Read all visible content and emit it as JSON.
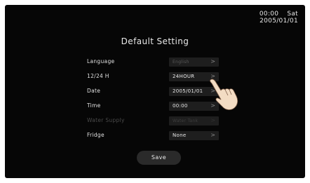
{
  "status": {
    "time": "00:00",
    "day": "Sat",
    "date": "2005/01/01"
  },
  "title": "Default Setting",
  "settings": [
    {
      "label": "Language",
      "value": "English",
      "state": "dim"
    },
    {
      "label": "12/24 H",
      "value": "24HOUR",
      "state": "active"
    },
    {
      "label": "Date",
      "value": "2005/01/01",
      "state": "active"
    },
    {
      "label": "Time",
      "value": "00:00",
      "state": "active"
    },
    {
      "label": "Water Supply",
      "value": "Water Tank",
      "state": "disabled"
    },
    {
      "label": "Fridge",
      "value": "None",
      "state": "active"
    }
  ],
  "save_label": "Save",
  "icons": {
    "arrow": "chevron-right-icon",
    "pointer": "hand-pointer-icon"
  },
  "colors": {
    "background": "#060606",
    "field": "#1e1e1e",
    "button": "#2a2a2a",
    "text": "#e8e8e8"
  }
}
